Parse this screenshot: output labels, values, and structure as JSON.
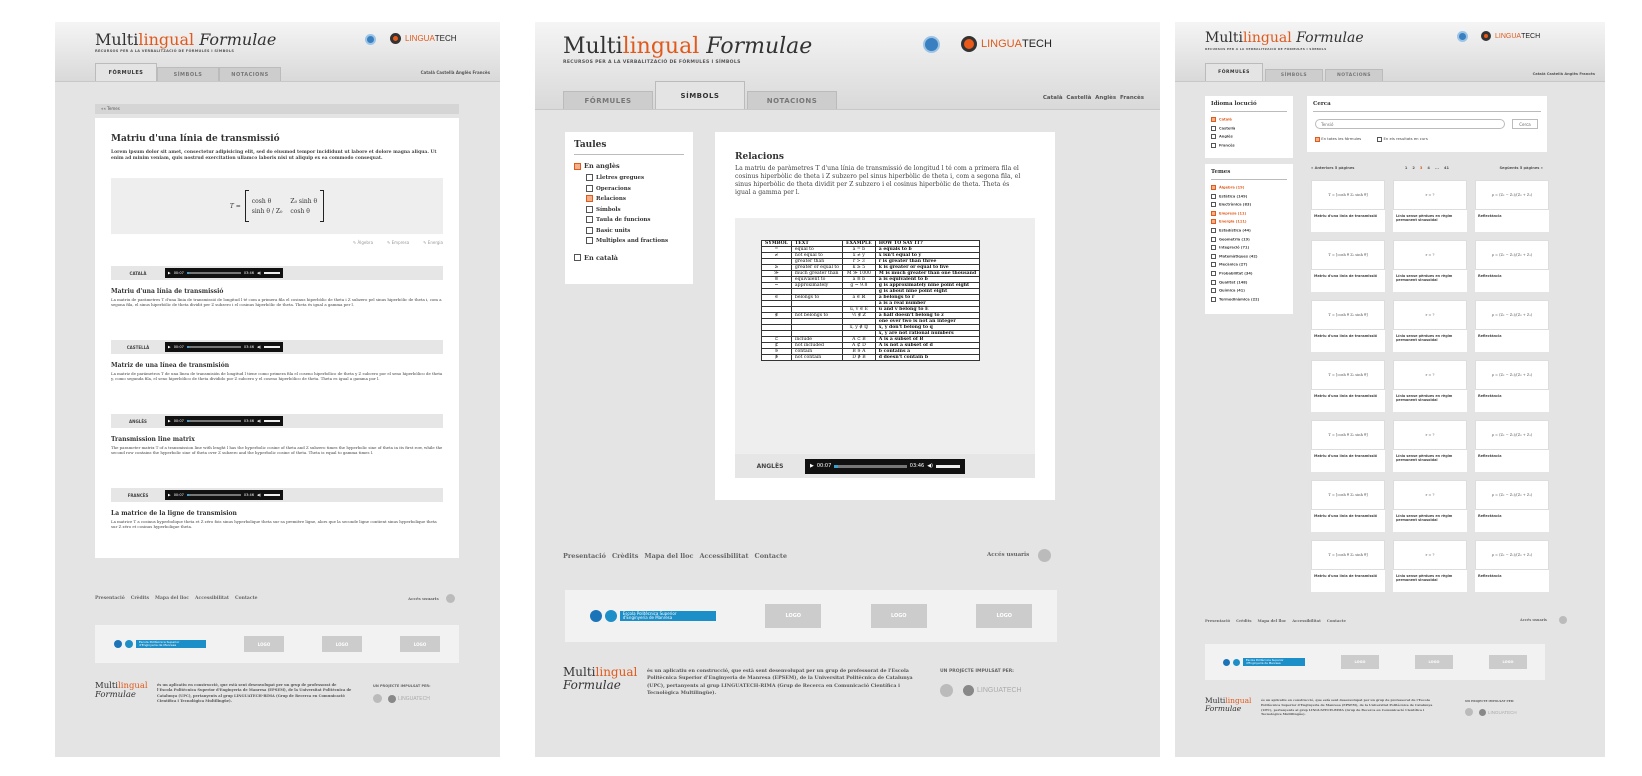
{
  "site": {
    "logo_pre": "Multi",
    "logo_mid": "lingual",
    "logo_post": "Formulae",
    "subtitle": "RECURSOS PER A LA VERBALITZACIÓ DE FÓRMULES I SÍMBOLS",
    "partner_a": "LINGUA",
    "partner_b": "TECH",
    "brand_color": "#e05a1c"
  },
  "tabs": [
    "FÓRMULES",
    "SÍMBOLS",
    "NOTACIONS"
  ],
  "languages": [
    "Català",
    "Castellà",
    "Anglès",
    "Francès"
  ],
  "breadcrumb": "Temes",
  "article": {
    "title": "Matriu d'una línia de transmissió",
    "lorem": "Lorem ipsum dolor sit amet, consectetur adipisicing elit, sed do eiusmod tempor incididunt ut labore et dolore magna aliqua. Ut enim ad minim veniam, quis nostrud exercitation ullamco laboris nisi ut aliquip ex ea commodo consequat.",
    "tags": [
      "Àlgebra",
      "Empresa",
      "Energia"
    ],
    "formula_T": "T =",
    "m11": "cosh θ",
    "m12": "Z₀ sinh θ",
    "m21": "sinh θ / Z₀",
    "m22": "cosh θ",
    "player_start": "00:07",
    "player_end": "03:46",
    "langs": [
      {
        "label": "CATALÀ",
        "title": "Matriu d'una línia de transmissió",
        "text": "La matriu de paràmetres T d'una línia de transmissió de longitud l té com a primera fila el cosinus hiperbòlic de theta i Z subzero pel sinus hiperbòlic de theta i, com a segona fila, el sinus hiperbòlic de theta dividit per Z subzero i el cosinus hiperbòlic de theta. Theta és igual a gamma per l."
      },
      {
        "label": "CASTELLÀ",
        "title": "Matriz de una línea de transmisión",
        "text": "La matriz de parámetros T de una línea de transmisión de longitud l tiene como primera fila el coseno hiperbólico de theta y Z subcero por el seno hiperbólico de theta y, como segunda fila, el seno hiperbólico de theta dividido por Z subcero y el coseno hiperbólico de theta. Theta es igual a gamma por l."
      },
      {
        "label": "ANGLÈS",
        "title": "Transmission line matrix",
        "text": "The parameter matrix T of a transmission line with lenght l has the hyperbolic cosine of theta and Z subzero times the hyperbolic sine of theta in its first row, while the second row contains the hyperbolic sine of theta over Z subzero and the hyperbolic cosine of theta. Theta is equal to gamma times l."
      },
      {
        "label": "FRANCÈS",
        "title": "La matrice de la ligne de transmision",
        "text": "La matrice T a cosinus hyperbolique theta et Z zéro fois sinus hyperbolique theta sur sa première ligne, alors que la seconde ligne contient sinus hyperbolique theta sur Z zéro et cosinus hyperbolique theta."
      }
    ]
  },
  "footer": {
    "links": [
      "Presentació",
      "Crèdits",
      "Mapa del lloc",
      "Accessibilitat",
      "Contacte"
    ],
    "login": "Accés usuaris",
    "logo_box": "LOGO",
    "epsem_line1": "Escola Politècnica Superior",
    "epsem_line2": "d'Enginyeria de Manresa",
    "description": "és un aplicatiu en construcció, que està sent desenvolupat per un grup de professorat de l'Escola Politècnica Superior d'Enginyeria de Manresa (EPSEM), de la Universitat Politècnica de Catalunya (UPC), pertanyents al grup LINGUATECH-RIMA (Grup de Recerca en Comunicació Científica i Tecnològica Multilingüe).",
    "impulsat": "UN PROJECTE IMPULSAT PER:"
  },
  "symbols_page": {
    "taules_title": "Taules",
    "tree": [
      {
        "label": "En anglès",
        "level": 0,
        "checked": true
      },
      {
        "label": "Lletres gregues",
        "level": 1,
        "checked": false
      },
      {
        "label": "Operacions",
        "level": 1,
        "checked": false
      },
      {
        "label": "Relacions",
        "level": 1,
        "checked": true
      },
      {
        "label": "Símbols",
        "level": 1,
        "checked": false
      },
      {
        "label": "Taula de funcions",
        "level": 1,
        "checked": false
      },
      {
        "label": "Basic units",
        "level": 1,
        "checked": false
      },
      {
        "label": "Multiples and fractions",
        "level": 1,
        "checked": false
      },
      {
        "label": "En català",
        "level": 0,
        "checked": false
      }
    ],
    "rel_title": "Relacions",
    "rel_text": "La matriu de paràmetres T d'una línia de transmissió de longitud l té com a primera fila el cosinus hiperbòlic de theta i Z subzero pel sinus hiperbòlic de theta i, com a segona fila, el sinus hiperbòlic de theta dividit per Z subzero i el cosinus hiperbòlic de theta. Theta és igual a gamma per l.",
    "table_headers": [
      "SYMBOL",
      "TEXT",
      "EXAMPLE",
      "HOW TO SAY IT?"
    ],
    "table_rows": [
      [
        "=",
        "equal to",
        "a = b",
        "a equals to b"
      ],
      [
        "≠",
        "not equal to",
        "x ≠ y",
        "x isn't equal to y"
      ],
      [
        "",
        "greater than",
        "r > 3",
        "r is greater than three"
      ],
      [
        "≥",
        "greater or equal to",
        "k ≥ 5",
        "k is greater or equal to five"
      ],
      [
        "≫",
        "much greater than",
        "M ≫ 1000",
        "M is much greater than one thousand"
      ],
      [
        "≡",
        "equivalent to",
        "a ≡ b",
        "a is equivalent to b"
      ],
      [
        "~",
        "approximately",
        "g ~ 9.8",
        "g is approximately nine point eight"
      ],
      [
        "",
        "",
        "",
        "g is about nine point eight"
      ],
      [
        "∈",
        "belongs to",
        "a ∈ ℝ",
        "a belongs to r"
      ],
      [
        "",
        "",
        "",
        "a is a real number"
      ],
      [
        "",
        "",
        "u, v ∈ E",
        "u and v belong to E"
      ],
      [
        "∉",
        "not belongs to",
        "½ ∉ ℤ",
        "a half doesn't belong to z"
      ],
      [
        "",
        "",
        "",
        "one over two is not an integer"
      ],
      [
        "",
        "",
        "x, y ∉ ℚ",
        "x, y don't belong to q"
      ],
      [
        "",
        "",
        "",
        "x, y are not rational numbers"
      ],
      [
        "⊂",
        "include",
        "A ⊂ B",
        "A is a subset of B"
      ],
      [
        "⊄",
        "not included",
        "A ⊄ D",
        "A is not a subset of d"
      ],
      [
        "∋",
        "contain",
        "B ∋ A",
        "b contains a"
      ],
      [
        "∌",
        "not contain",
        "D ∌ B",
        "d doesn't contain b"
      ]
    ],
    "audio_label": "ANGLÈS"
  },
  "formulas_page": {
    "idioma_title": "Idioma locució",
    "idiomes": [
      {
        "label": "Català",
        "checked": true
      },
      {
        "label": "Castellà",
        "checked": false
      },
      {
        "label": "Anglès",
        "checked": false
      },
      {
        "label": "Francès",
        "checked": false
      }
    ],
    "temes_title": "Temes",
    "temes": [
      {
        "label": "Àlgebra (19)",
        "checked": true
      },
      {
        "label": "Estàtica (149)",
        "checked": false
      },
      {
        "label": "Electrònica (83)",
        "checked": false
      },
      {
        "label": "Empresa (11)",
        "checked": true
      },
      {
        "label": "Energia (111)",
        "checked": true
      },
      {
        "label": "Estadística (44)",
        "checked": false
      },
      {
        "label": "Geometria (19)",
        "checked": false
      },
      {
        "label": "Integració (71)",
        "checked": false
      },
      {
        "label": "Matemàtiques (42)",
        "checked": false
      },
      {
        "label": "Mecànica (27)",
        "checked": false
      },
      {
        "label": "Probabilitat (34)",
        "checked": false
      },
      {
        "label": "Qualitat (148)",
        "checked": false
      },
      {
        "label": "Química (41)",
        "checked": false
      },
      {
        "label": "Termodinàmica (22)",
        "checked": false
      }
    ],
    "cerca_title": "Cerca",
    "search_placeholder": "Tensió",
    "search_button": "Cerca",
    "opt1": "En totes les fórmules",
    "opt2": "En els resultats en curs",
    "pag_prev": "« Anteriors 5 pàgines",
    "pag_pages": [
      "1",
      "2",
      "3",
      "4",
      "...",
      "41"
    ],
    "pag_next": "Següents 5 pàgines »",
    "captions": [
      "Matriu d'una línia de transmissió",
      "Línia sense pèrdues en règim permanent sinusoïdal",
      "Reflectància"
    ],
    "fx": [
      "T = [cosh θ  Z₀ sinh θ]",
      "r = ?",
      "ρ = (Z₂ − Z₁)/(Z₂ + Z₁)"
    ]
  }
}
